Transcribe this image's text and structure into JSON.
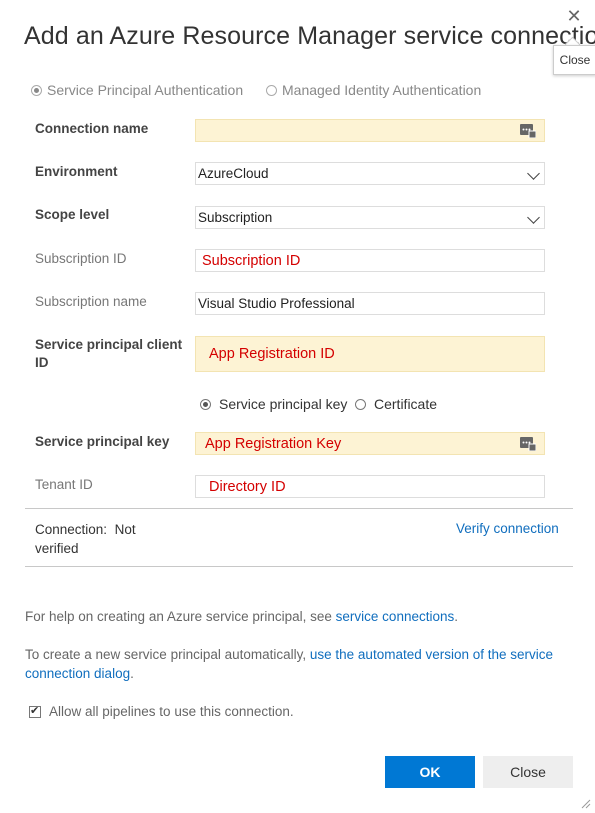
{
  "dialog": {
    "title": "Add an Azure Resource Manager service connection",
    "close_tooltip": "Close"
  },
  "auth_options": [
    {
      "label": "Service Principal Authentication",
      "selected": true
    },
    {
      "label": "Managed Identity Authentication",
      "selected": false
    }
  ],
  "fields": {
    "connection_name": {
      "label": "Connection name",
      "value": ""
    },
    "environment": {
      "label": "Environment",
      "value": "AzureCloud"
    },
    "scope_level": {
      "label": "Scope level",
      "value": "Subscription"
    },
    "subscription_id": {
      "label": "Subscription ID",
      "value": "Subscription ID"
    },
    "subscription_name": {
      "label": "Subscription name",
      "value": "Visual Studio Professional"
    },
    "client_id": {
      "label": "Service principal client ID",
      "value": "App Registration ID"
    },
    "principal_key": {
      "label": "Service principal key",
      "value": "App Registration Key"
    },
    "tenant_id": {
      "label": "Tenant ID",
      "value": "Directory ID"
    }
  },
  "credential_type": [
    {
      "label": "Service principal key",
      "selected": true
    },
    {
      "label": "Certificate",
      "selected": false
    }
  ],
  "connection": {
    "status_label": "Connection:",
    "status_value": "Not verified",
    "verify_link": "Verify connection"
  },
  "help": {
    "line1_text": "For help on creating an Azure service principal, see ",
    "line1_link": "service connections",
    "line1_end": ".",
    "line2_text": "To create a new service principal automatically, ",
    "line2_link": "use the automated version of the service connection dialog",
    "line2_end": "."
  },
  "allow_pipelines": {
    "label": "Allow all pipelines to use this connection.",
    "checked": true
  },
  "buttons": {
    "ok": "OK",
    "close": "Close"
  },
  "colors": {
    "primary": "#0078d4",
    "link": "#106ebe",
    "required_bg": "#fdf3d4",
    "annotation_red": "#d40000"
  },
  "icons": {
    "close": "close-icon",
    "password_helper": "password-field-icon",
    "dropdown": "chevron-down-icon"
  }
}
